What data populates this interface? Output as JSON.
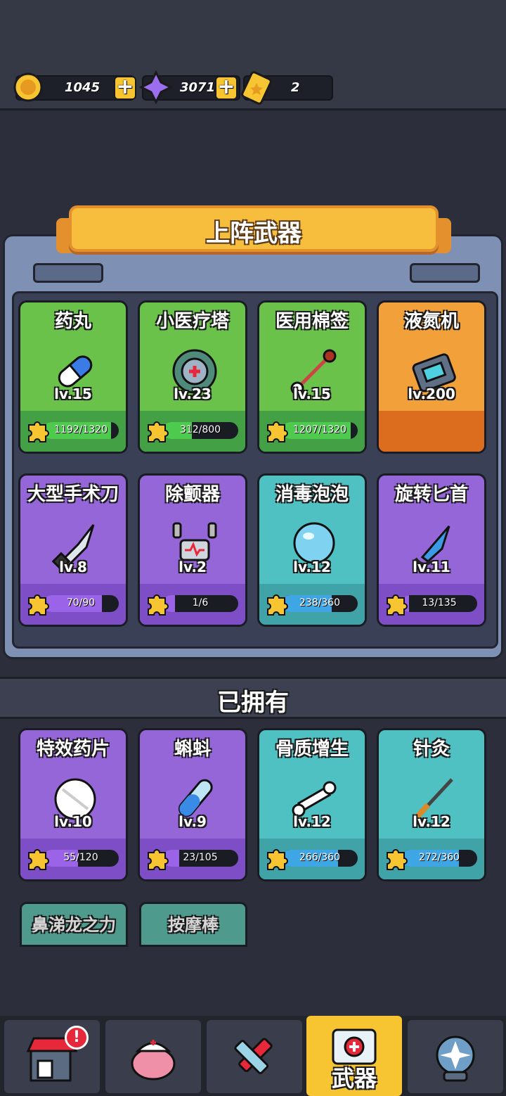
{
  "resources": {
    "coins": "1045",
    "gems": "3071",
    "tickets": "2"
  },
  "deployed": {
    "title": "上阵武器",
    "cards": [
      {
        "name": "药丸",
        "level": "lv.15",
        "progress": "1192/1320",
        "fill": 0.9,
        "color": "green",
        "icon": "pill-icon"
      },
      {
        "name": "小医疗塔",
        "level": "lv.23",
        "progress": "312/800",
        "fill": 0.39,
        "color": "green",
        "icon": "medical-tower-icon"
      },
      {
        "name": "医用棉签",
        "level": "lv.15",
        "progress": "1207/1320",
        "fill": 0.91,
        "color": "green",
        "icon": "cotton-swab-icon"
      },
      {
        "name": "液氮机",
        "level": "lv.200",
        "progress": "",
        "fill": 0,
        "color": "orange",
        "icon": "liquid-nitrogen-machine-icon"
      },
      {
        "name": "大型手术刀",
        "level": "lv.8",
        "progress": "70/90",
        "fill": 0.78,
        "color": "purple",
        "icon": "scalpel-icon"
      },
      {
        "name": "除颤器",
        "level": "lv.2",
        "progress": "1/6",
        "fill": 0.17,
        "color": "purple",
        "icon": "defibrillator-icon"
      },
      {
        "name": "消毒泡泡",
        "level": "lv.12",
        "progress": "238/360",
        "fill": 0.66,
        "color": "teal",
        "icon": "bubble-icon"
      },
      {
        "name": "旋转匕首",
        "level": "lv.11",
        "progress": "13/135",
        "fill": 0.1,
        "color": "purple",
        "icon": "dagger-icon"
      }
    ]
  },
  "owned": {
    "title": "已拥有",
    "cards": [
      {
        "name": "特效药片",
        "level": "lv.10",
        "progress": "55/120",
        "fill": 0.46,
        "color": "purple",
        "icon": "tablet-icon"
      },
      {
        "name": "蝌蚪",
        "level": "lv.9",
        "progress": "23/105",
        "fill": 0.22,
        "color": "purple",
        "icon": "test-tube-icon"
      },
      {
        "name": "骨质增生",
        "level": "lv.12",
        "progress": "266/360",
        "fill": 0.74,
        "color": "teal",
        "icon": "bone-icon"
      },
      {
        "name": "针灸",
        "level": "lv.12",
        "progress": "272/360",
        "fill": 0.76,
        "color": "teal",
        "icon": "needle-icon"
      }
    ],
    "locked": [
      "鼻涕龙之力",
      "按摩棒"
    ]
  },
  "nav": {
    "items": [
      {
        "icon": "shop-icon",
        "label": "",
        "badge": "!"
      },
      {
        "icon": "brain-icon",
        "label": ""
      },
      {
        "icon": "syringe-icon",
        "label": ""
      },
      {
        "icon": "medkit-icon",
        "label": "武器",
        "active": true
      },
      {
        "icon": "crystal-icon",
        "label": ""
      }
    ]
  }
}
